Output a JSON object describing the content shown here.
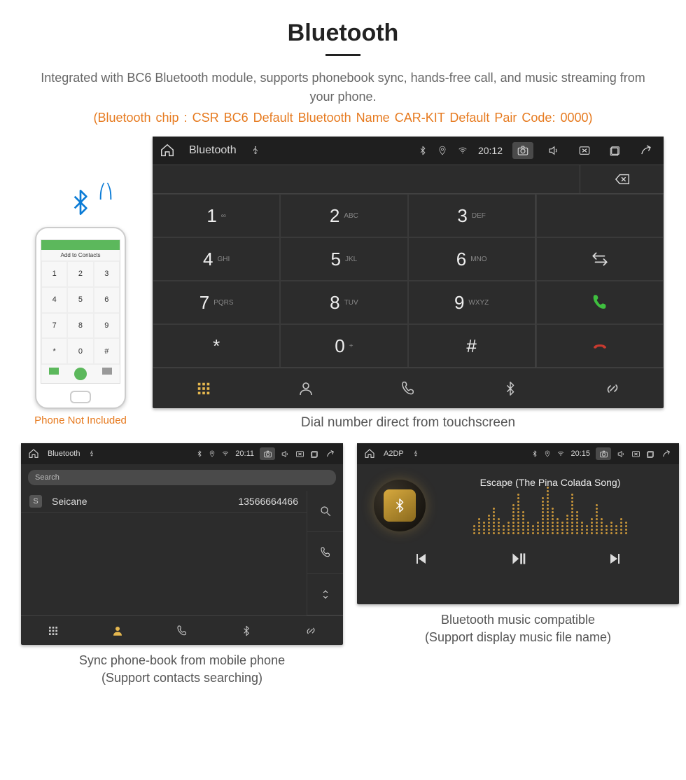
{
  "heading": "Bluetooth",
  "description": "Integrated with BC6 Bluetooth module, supports phonebook sync, hands-free call, and music streaming from your phone.",
  "chipLine": "(Bluetooth chip : CSR BC6     Default Bluetooth Name CAR-KIT    Default Pair Code: 0000)",
  "phoneCaption": "Phone Not Included",
  "mockPhone": {
    "addLabel": "Add to Contacts",
    "keys": [
      "1",
      "2",
      "3",
      "4",
      "5",
      "6",
      "7",
      "8",
      "9",
      "*",
      "0",
      "#"
    ]
  },
  "dialer": {
    "status": {
      "app": "Bluetooth",
      "time": "20:12"
    },
    "keys": [
      {
        "n": "1",
        "s": "∞"
      },
      {
        "n": "2",
        "s": "ABC"
      },
      {
        "n": "3",
        "s": "DEF"
      },
      {
        "n": "4",
        "s": "GHI"
      },
      {
        "n": "5",
        "s": "JKL"
      },
      {
        "n": "6",
        "s": "MNO"
      },
      {
        "n": "7",
        "s": "PQRS"
      },
      {
        "n": "8",
        "s": "TUV"
      },
      {
        "n": "9",
        "s": "WXYZ"
      },
      {
        "n": "*",
        "s": ""
      },
      {
        "n": "0",
        "s": "+"
      },
      {
        "n": "#",
        "s": ""
      }
    ],
    "caption": "Dial number direct from touchscreen"
  },
  "phonebook": {
    "status": {
      "app": "Bluetooth",
      "time": "20:11"
    },
    "searchPlaceholder": "Search",
    "entries": [
      {
        "badge": "S",
        "name": "Seicane",
        "number": "13566664466"
      }
    ],
    "caption1": "Sync phone-book from mobile phone",
    "caption2": "(Support contacts searching)"
  },
  "music": {
    "status": {
      "app": "A2DP",
      "time": "20:15"
    },
    "song": "Escape (The Pina Colada Song)",
    "eq": [
      3,
      5,
      4,
      6,
      8,
      5,
      3,
      4,
      9,
      12,
      7,
      4,
      3,
      4,
      11,
      14,
      8,
      5,
      4,
      6,
      12,
      7,
      4,
      3,
      5,
      9,
      5,
      3,
      4,
      3,
      5,
      4
    ],
    "caption1": "Bluetooth music compatible",
    "caption2": "(Support display music file name)"
  }
}
